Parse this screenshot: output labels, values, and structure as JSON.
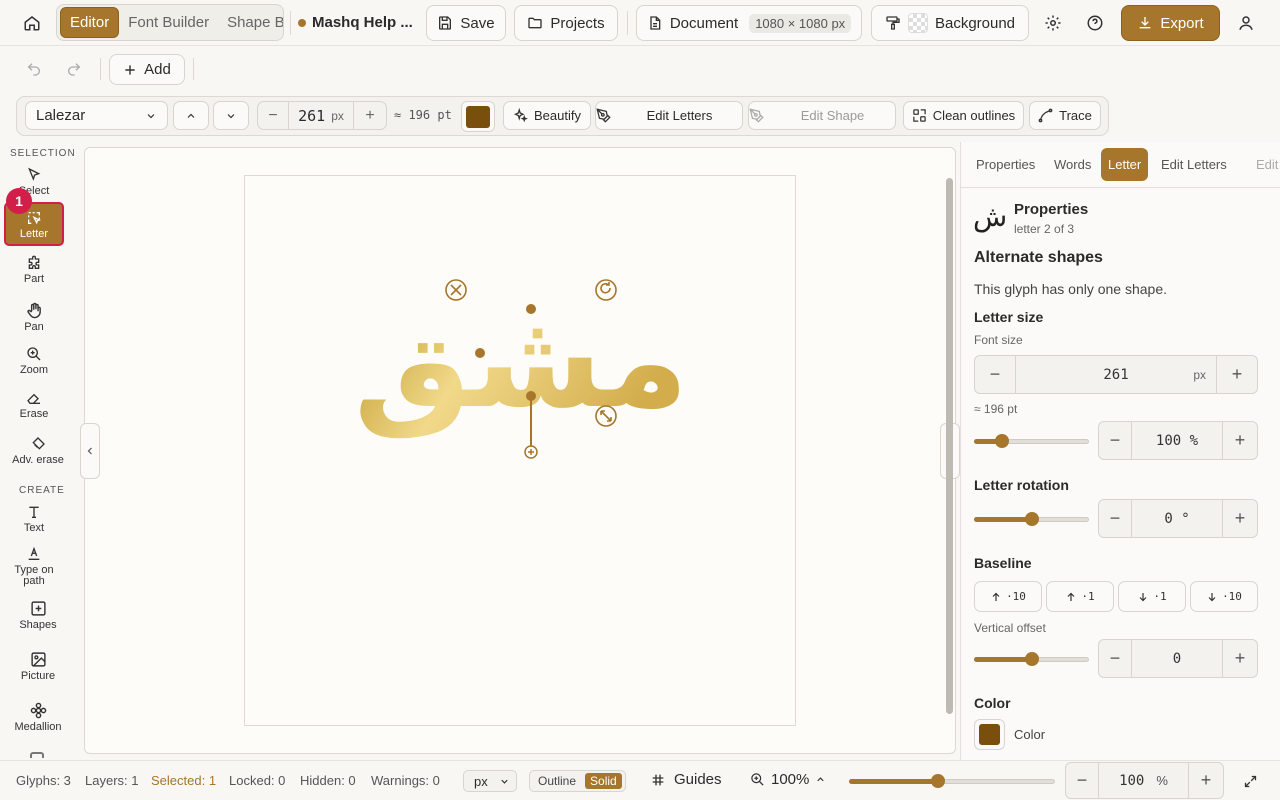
{
  "top": {
    "modes": [
      "Editor",
      "Font Builder",
      "Shape Builder"
    ],
    "project_title": "Mashq Help ...",
    "save": "Save",
    "projects": "Projects",
    "document_label": "Document",
    "document_size": "1080 × 1080 px",
    "background": "Background",
    "export": "Export"
  },
  "row2": {
    "add": "Add"
  },
  "toolbar": {
    "font": "Lalezar",
    "size_value": "261",
    "size_unit": "px",
    "pt_approx": "≈ 196 pt",
    "color": "#7a4f0d",
    "beautify": "Beautify",
    "edit_letters": "Edit Letters",
    "edit_shape": "Edit Shape",
    "clean_outlines": "Clean outlines",
    "trace": "Trace"
  },
  "tools": {
    "selection_header": "SELECTION",
    "create_header": "CREATE",
    "select": "Select",
    "letter": "Letter",
    "part": "Part",
    "pan": "Pan",
    "zoom": "Zoom",
    "erase": "Erase",
    "adv_erase": "Adv. erase",
    "text": "Text",
    "type_on_path": "Type on path",
    "shapes": "Shapes",
    "picture": "Picture",
    "medallion": "Medallion",
    "badge": "1"
  },
  "canvas": {
    "text": "مشق"
  },
  "panel": {
    "tabs": [
      "Properties",
      "Words",
      "Letter",
      "Edit Letters",
      "Edit"
    ],
    "glyph": "ش",
    "title": "Properties",
    "subtitle": "letter 2 of 3",
    "alt_heading": "Alternate shapes",
    "alt_text": "This glyph has only one shape.",
    "letter_size": "Letter size",
    "font_size_label": "Font size",
    "font_size": "261",
    "font_size_unit": "px",
    "pt": "≈ 196 pt",
    "scale": "100 %",
    "scale_fraction": 0.24,
    "rotation_heading": "Letter rotation",
    "rotation": "0 °",
    "rotation_fraction": 0.5,
    "baseline_heading": "Baseline",
    "nudges": [
      "·10",
      "·1",
      "·1",
      "·10"
    ],
    "vertical_offset_label": "Vertical offset",
    "vertical_offset": "0",
    "offset_fraction": 0.5,
    "color_heading": "Color",
    "color_label": "Color",
    "color": "#7a4f0d"
  },
  "status": {
    "glyphs": "Glyphs: 3",
    "layers": "Layers: 1",
    "selected": "Selected: 1",
    "locked": "Locked: 0",
    "hidden": "Hidden: 0",
    "warnings": "Warnings: 0",
    "unit": "px",
    "outline": "Outline",
    "solid": "Solid",
    "guides": "Guides",
    "zoom": "100%",
    "zoom_fraction": 0.43,
    "zoom_value": "100",
    "zoom_unit": "%"
  },
  "colors": {
    "accent": "#a5762b",
    "badge": "#d21f4a"
  }
}
